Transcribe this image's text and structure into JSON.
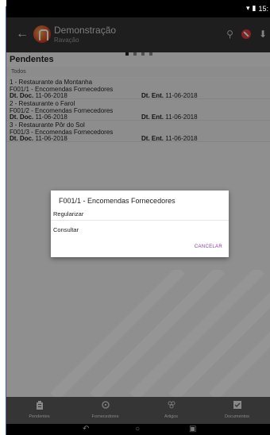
{
  "status_bar": {
    "time": "15:"
  },
  "app_bar": {
    "title": "Demonstração",
    "subtitle": "Ravação"
  },
  "section": {
    "title": "Pendentes",
    "filter": "Todos"
  },
  "list": [
    {
      "line1": "1 - Restaurante da Montanha",
      "line2": "F001/1 - Encomendas Fornecedores",
      "doc_label": "Dt. Doc.",
      "doc_date": "11-06-2018",
      "ent_label": "Dt. Ent.",
      "ent_date": "11-06-2018"
    },
    {
      "line1": "2 - Restaurante o Farol",
      "line2": "F001/2 - Encomendas Fornecedores",
      "doc_label": "Dt. Doc.",
      "doc_date": "11-06-2018",
      "ent_label": "Dt. Ent.",
      "ent_date": "11-06-2018"
    },
    {
      "line1": "3 - Restaurante Pôr do Sol",
      "line2": "F001/3 - Encomendas Fornecedores",
      "doc_label": "Dt. Doc.",
      "doc_date": "11-06-2018",
      "ent_label": "Dt. Ent.",
      "ent_date": "11-06-2018"
    }
  ],
  "dialog": {
    "title": "F001/1 - Encomendas Fornecedores",
    "option1": "Regularizar",
    "option2": "Consultar",
    "cancel": "CANCELAR"
  },
  "bottom_nav": [
    {
      "label": "Pendentes",
      "icon": "clipboard-icon"
    },
    {
      "label": "Fornecedores",
      "icon": "truck-icon"
    },
    {
      "label": "Artigos",
      "icon": "boxes-icon"
    },
    {
      "label": "Documentos",
      "icon": "check-doc-icon"
    }
  ],
  "colors": {
    "accent": "#8e3aa6",
    "app_bar": "#333333",
    "logo": "#c6391d"
  }
}
